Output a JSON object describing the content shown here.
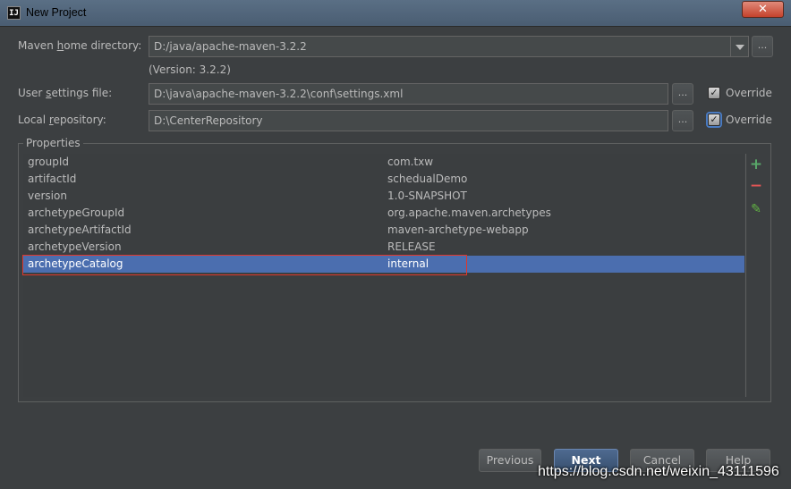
{
  "window": {
    "title": "New Project",
    "close_glyph": "✕"
  },
  "maven": {
    "home_label_pre": "Maven ",
    "home_label_u": "h",
    "home_label_post": "ome directory:",
    "home_value": "D:/java/apache-maven-3.2.2",
    "version_text": "(Version: 3.2.2)",
    "settings_label_pre": "User ",
    "settings_label_u": "s",
    "settings_label_post": "ettings file:",
    "settings_value": "D:\\java\\apache-maven-3.2.2\\conf\\settings.xml",
    "repo_label_pre": "Local ",
    "repo_label_u": "r",
    "repo_label_post": "epository:",
    "repo_value": "D:\\CenterRepository",
    "browse_glyph": "...",
    "override_label": "Override",
    "check_glyph": "✓"
  },
  "properties": {
    "title": "Properties",
    "rows": [
      {
        "key": "groupId",
        "value": "com.txw"
      },
      {
        "key": "artifactId",
        "value": "schedualDemo"
      },
      {
        "key": "version",
        "value": "1.0-SNAPSHOT"
      },
      {
        "key": "archetypeGroupId",
        "value": "org.apache.maven.archetypes"
      },
      {
        "key": "archetypeArtifactId",
        "value": "maven-archetype-webapp"
      },
      {
        "key": "archetypeVersion",
        "value": "RELEASE"
      },
      {
        "key": "archetypeCatalog",
        "value": "internal"
      }
    ],
    "selected_index": 6,
    "tools": {
      "add": "+",
      "remove": "−",
      "edit": "✎"
    }
  },
  "buttons": {
    "previous": "Previous",
    "next": "Next",
    "cancel": "Cancel",
    "help": "Help"
  },
  "watermark": "https://blog.csdn.net/weixin_43111596",
  "colors": {
    "background": "#3c3f41",
    "selection": "#4b6eaf",
    "add": "#59a869",
    "remove": "#e05555",
    "edit": "#62b543",
    "highlight": "#e0382b"
  },
  "icons": [
    "intellij-logo-icon",
    "close-icon",
    "dropdown-arrow-icon",
    "checkbox-checked-icon",
    "add-icon",
    "remove-icon",
    "edit-pencil-icon"
  ]
}
